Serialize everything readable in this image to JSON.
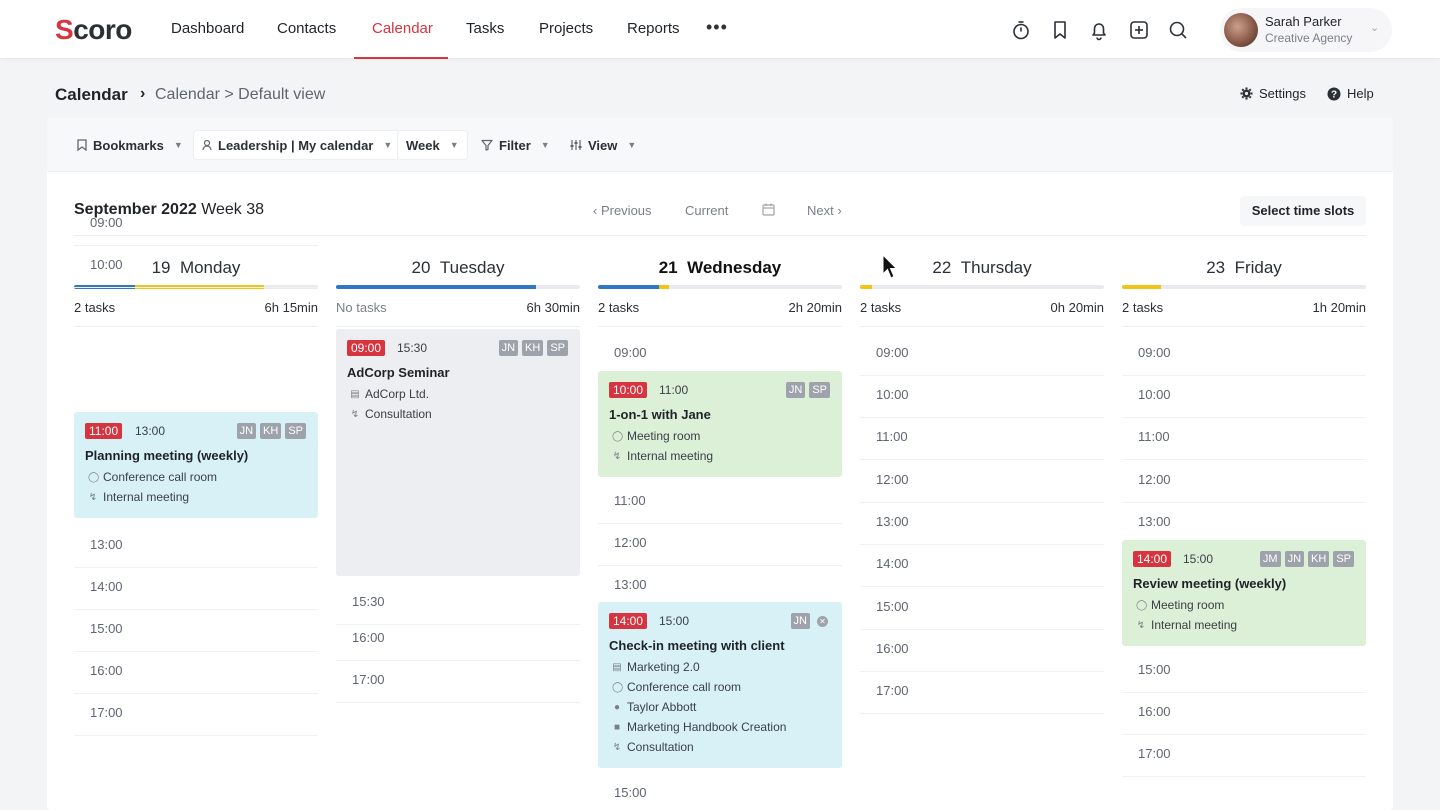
{
  "nav": {
    "logo": "Scoro",
    "items": [
      "Dashboard",
      "Contacts",
      "Calendar",
      "Tasks",
      "Projects",
      "Reports"
    ],
    "active": "Calendar",
    "more": "•••",
    "icons": [
      "timer-icon",
      "bookmark-icon",
      "bell-icon",
      "add-icon",
      "search-icon"
    ]
  },
  "user": {
    "name": "Sarah Parker",
    "company": "Creative Agency"
  },
  "breadcrumb": {
    "main": "Calendar",
    "sep": "›",
    "sub": "Calendar > Default view"
  },
  "header_links": {
    "settings": "Settings",
    "help": "Help"
  },
  "toolbar": {
    "bookmarks": "Bookmarks",
    "calendar": "Leadership | My calendar",
    "period": "Week",
    "filter": "Filter",
    "view": "View"
  },
  "period": {
    "month": "September 2022",
    "week": "Week 38"
  },
  "period_nav": {
    "previous": "Previous",
    "current": "Current",
    "next": "Next"
  },
  "select_slots": "Select time slots",
  "colors": {
    "accent": "#d6343f",
    "blue_bar": "#2f78c4",
    "yellow_bar": "#f2c417",
    "event_blue": "#d8f1f7",
    "event_green": "#dcefd7",
    "event_grey": "#eceef2"
  },
  "days": [
    {
      "date": "19",
      "name": "Monday",
      "today": false,
      "tasks": "2 tasks",
      "duration": "6h 15min",
      "hours_before": [
        "09:00",
        "10:00"
      ],
      "events": [
        {
          "start": "11:00",
          "end": "13:00",
          "initials": [
            "JN",
            "KH",
            "SP"
          ],
          "title": "Planning meeting (weekly)",
          "color": "blue",
          "rows": [
            {
              "icon": "location-icon",
              "text": "Conference call room"
            },
            {
              "icon": "bolt-icon",
              "text": "Internal meeting"
            }
          ]
        }
      ],
      "hours_after": [
        "13:00",
        "14:00",
        "15:00",
        "16:00",
        "17:00"
      ]
    },
    {
      "date": "20",
      "name": "Tuesday",
      "today": false,
      "tasks": "No tasks",
      "duration": "6h 30min",
      "hours_before": [],
      "events": [
        {
          "start": "09:00",
          "end": "15:30",
          "initials": [
            "JN",
            "KH",
            "SP"
          ],
          "title": "AdCorp Seminar",
          "color": "grey",
          "rows": [
            {
              "icon": "building-icon",
              "text": "AdCorp Ltd."
            },
            {
              "icon": "bolt-icon",
              "text": "Consultation"
            }
          ]
        }
      ],
      "hours_after": [
        "15:30",
        "16:00",
        "17:00"
      ]
    },
    {
      "date": "21",
      "name": "Wednesday",
      "today": true,
      "tasks": "2 tasks",
      "duration": "2h 20min",
      "hours_before": [
        "09:00"
      ],
      "events": [
        {
          "start": "10:00",
          "end": "11:00",
          "initials": [
            "JN",
            "SP"
          ],
          "title": "1-on-1 with Jane",
          "color": "green",
          "rows": [
            {
              "icon": "location-icon",
              "text": "Meeting room"
            },
            {
              "icon": "bolt-icon",
              "text": "Internal meeting"
            }
          ]
        },
        {
          "start": "14:00",
          "end": "15:00",
          "initials": [
            "JN"
          ],
          "title": "Check-in meeting with client",
          "color": "blue",
          "rows": [
            {
              "icon": "project-icon",
              "text": "Marketing 2.0"
            },
            {
              "icon": "location-icon",
              "text": "Conference call room"
            },
            {
              "icon": "person-icon",
              "text": "Taylor Abbott"
            },
            {
              "icon": "briefcase-icon",
              "text": "Marketing Handbook Creation"
            },
            {
              "icon": "bolt-icon",
              "text": "Consultation"
            }
          ]
        }
      ],
      "hours_mid": [
        "11:00",
        "12:00",
        "13:00"
      ],
      "hours_after": [
        "15:00"
      ]
    },
    {
      "date": "22",
      "name": "Thursday",
      "today": false,
      "tasks": "2 tasks",
      "duration": "0h 20min",
      "hours_before": [
        "09:00",
        "10:00",
        "11:00",
        "12:00",
        "13:00",
        "14:00",
        "15:00",
        "16:00",
        "17:00"
      ],
      "events": [],
      "hours_after": []
    },
    {
      "date": "23",
      "name": "Friday",
      "today": false,
      "tasks": "2 tasks",
      "duration": "1h 20min",
      "hours_before": [
        "09:00",
        "10:00",
        "11:00",
        "12:00",
        "13:00"
      ],
      "events": [
        {
          "start": "14:00",
          "end": "15:00",
          "initials": [
            "JM",
            "JN",
            "KH",
            "SP"
          ],
          "title": "Review meeting (weekly)",
          "color": "green",
          "rows": [
            {
              "icon": "location-icon",
              "text": "Meeting room"
            },
            {
              "icon": "bolt-icon",
              "text": "Internal meeting"
            }
          ]
        }
      ],
      "hours_after": [
        "15:00",
        "16:00",
        "17:00"
      ]
    }
  ],
  "day_bars": [
    {
      "blue": 0.25,
      "yellow": 0.53
    },
    {
      "blue": 0.82,
      "yellow": 0
    },
    {
      "blue": 0.25,
      "yellow": 0.04
    },
    {
      "blue": 0,
      "yellow": 0.05
    },
    {
      "blue": 0,
      "yellow": 0.16
    }
  ]
}
